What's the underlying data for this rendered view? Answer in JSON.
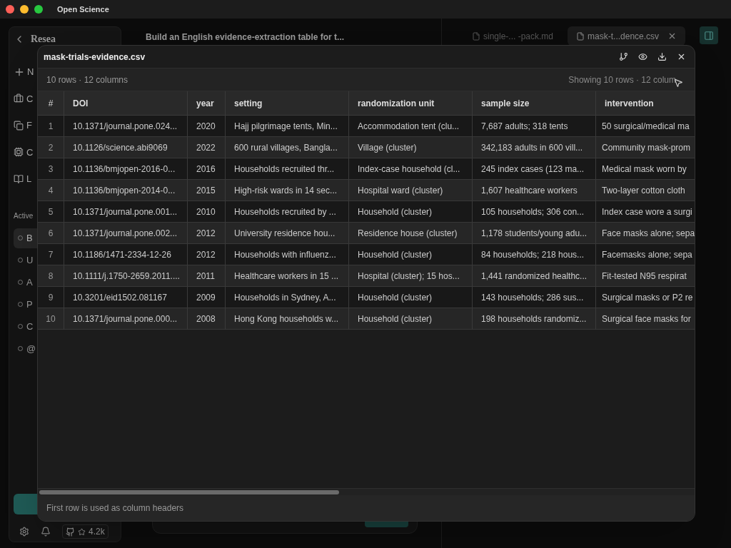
{
  "window": {
    "title": "Open Science"
  },
  "sidebar": {
    "title": "Resea",
    "new_label": "N",
    "nav": [
      "C",
      "F",
      "C",
      "L"
    ],
    "section": "Active",
    "items": [
      {
        "label": "B",
        "selected": true
      },
      {
        "label": "U",
        "selected": false
      },
      {
        "label": "A",
        "selected": false
      },
      {
        "label": "P",
        "selected": false
      },
      {
        "label": "C",
        "selected": false
      },
      {
        "label": "@",
        "selected": false
      }
    ],
    "stars": "4.2k"
  },
  "chat": {
    "title": "Build an English evidence-extraction table for t..."
  },
  "tabs": [
    {
      "label": "single-... -pack.md",
      "selected": false
    },
    {
      "label": "mask-t...dence.csv",
      "selected": true
    }
  ],
  "viewer": {
    "filename": "mask-trials-evidence.csv",
    "summary": "10 rows · 12 columns",
    "showing": "Showing 10 rows · 12 colum",
    "columns": [
      "#",
      "DOI",
      "year",
      "setting",
      "randomization unit",
      "sample size",
      "intervention"
    ],
    "rows": [
      [
        "1",
        "10.1371/journal.pone.024...",
        "2020",
        "Hajj pilgrimage tents, Min...",
        "Accommodation tent (clu...",
        "7,687 adults; 318 tents",
        "50 surgical/medical ma"
      ],
      [
        "2",
        "10.1126/science.abi9069",
        "2022",
        "600 rural villages, Bangla...",
        "Village (cluster)",
        "342,183 adults in 600 vill...",
        "Community mask-prom"
      ],
      [
        "3",
        "10.1136/bmjopen-2016-0...",
        "2016",
        "Households recruited thr...",
        "Index-case household (cl...",
        "245 index cases (123 ma...",
        "Medical mask worn by"
      ],
      [
        "4",
        "10.1136/bmjopen-2014-0...",
        "2015",
        "High-risk wards in 14 sec...",
        "Hospital ward (cluster)",
        "1,607 healthcare workers",
        "Two-layer cotton cloth"
      ],
      [
        "5",
        "10.1371/journal.pone.001...",
        "2010",
        "Households recruited by ...",
        "Household (cluster)",
        "105 households; 306 con...",
        "Index case wore a surgi"
      ],
      [
        "6",
        "10.1371/journal.pone.002...",
        "2012",
        "University residence hou...",
        "Residence house (cluster)",
        "1,178 students/young adu...",
        "Face masks alone; sepa"
      ],
      [
        "7",
        "10.1186/1471-2334-12-26",
        "2012",
        "Households with influenz...",
        "Household (cluster)",
        "84 households; 218 hous...",
        "Facemasks alone; sepa"
      ],
      [
        "8",
        "10.1111/j.1750-2659.2011....",
        "2011",
        "Healthcare workers in 15 ...",
        "Hospital (cluster); 15 hos...",
        "1,441 randomized healthc...",
        "Fit-tested N95 respirat"
      ],
      [
        "9",
        "10.3201/eid1502.081167",
        "2009",
        "Households in Sydney, A...",
        "Household (cluster)",
        "143 households; 286 sus...",
        "Surgical masks or P2 re"
      ],
      [
        "10",
        "10.1371/journal.pone.000...",
        "2008",
        "Hong Kong households w...",
        "Household (cluster)",
        "198 households randomiz...",
        "Surgical face masks for"
      ]
    ],
    "footer": "First row is used as column headers"
  }
}
